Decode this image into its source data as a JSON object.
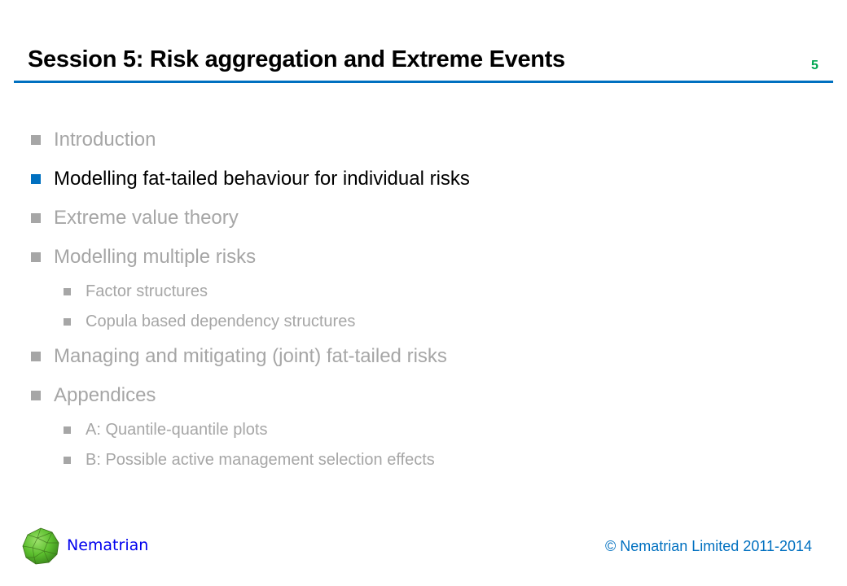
{
  "slide": {
    "title": "Session 5: Risk aggregation and Extreme Events",
    "page_number": "5"
  },
  "bullets": [
    {
      "level": 1,
      "text": "Introduction",
      "active": false
    },
    {
      "level": 1,
      "text": "Modelling fat-tailed behaviour for individual risks",
      "active": true
    },
    {
      "level": 1,
      "text": "Extreme value theory",
      "active": false
    },
    {
      "level": 1,
      "text": "Modelling multiple risks",
      "active": false
    },
    {
      "level": 2,
      "text": "Factor structures",
      "active": false
    },
    {
      "level": 2,
      "text": "Copula based dependency structures",
      "active": false
    },
    {
      "level": 1,
      "text": "Managing and mitigating (joint) fat-tailed risks",
      "active": false
    },
    {
      "level": 1,
      "text": "Appendices",
      "active": false
    },
    {
      "level": 2,
      "text": "A: Quantile-quantile plots",
      "active": false
    },
    {
      "level": 2,
      "text": "B: Possible active management selection effects",
      "active": false
    }
  ],
  "footer": {
    "brand": "Nematrian",
    "logo_icon": "geodesic-sphere-icon",
    "copyright": "© Nematrian Limited 2011-2014"
  },
  "colors": {
    "accent": "#0070c0",
    "page_number": "#00a651",
    "inactive": "#a6a6a6",
    "brand": "#0000ee"
  }
}
